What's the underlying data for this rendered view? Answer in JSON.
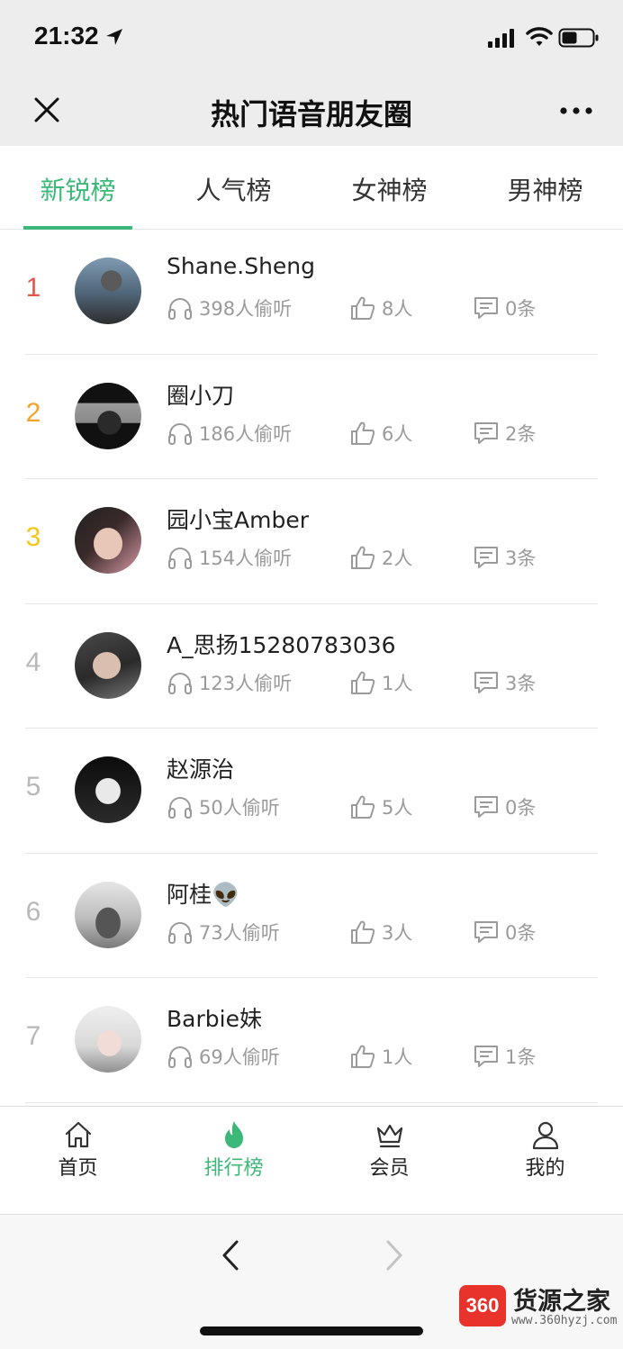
{
  "status_bar": {
    "time": "21:32"
  },
  "nav": {
    "title": "热门语音朋友圈"
  },
  "tabs": [
    {
      "label": "新锐榜"
    },
    {
      "label": "人气榜"
    },
    {
      "label": "女神榜"
    },
    {
      "label": "男神榜"
    }
  ],
  "active_tab": "新锐榜",
  "rank_colors": {
    "1": "#e2574c",
    "2": "#f0a42e",
    "3": "#f5c518",
    "other": "#b8b8b8"
  },
  "accent_color": "#3cb878",
  "items": [
    {
      "rank": "1",
      "name": "Shane.Sheng",
      "listens": "398人偷听",
      "likes": "8人",
      "comments": "0条"
    },
    {
      "rank": "2",
      "name": "圈小刀",
      "listens": "186人偷听",
      "likes": "6人",
      "comments": "2条"
    },
    {
      "rank": "3",
      "name": "园小宝Amber",
      "listens": "154人偷听",
      "likes": "2人",
      "comments": "3条"
    },
    {
      "rank": "4",
      "name": "A_思扬15280783036",
      "listens": "123人偷听",
      "likes": "1人",
      "comments": "3条"
    },
    {
      "rank": "5",
      "name": "赵源治",
      "listens": "50人偷听",
      "likes": "5人",
      "comments": "0条"
    },
    {
      "rank": "6",
      "name": "阿桂👽",
      "listens": "73人偷听",
      "likes": "3人",
      "comments": "0条"
    },
    {
      "rank": "7",
      "name": "Barbie妹",
      "listens": "69人偷听",
      "likes": "1人",
      "comments": "1条"
    }
  ],
  "bottom_tabs": [
    {
      "label": "首页",
      "icon": "home-icon"
    },
    {
      "label": "排行榜",
      "icon": "flame-icon"
    },
    {
      "label": "会员",
      "icon": "crown-icon"
    },
    {
      "label": "我的",
      "icon": "user-icon"
    }
  ],
  "watermark": {
    "logo": "360",
    "title": "货源之家",
    "url": "www.360hyzj.com"
  }
}
